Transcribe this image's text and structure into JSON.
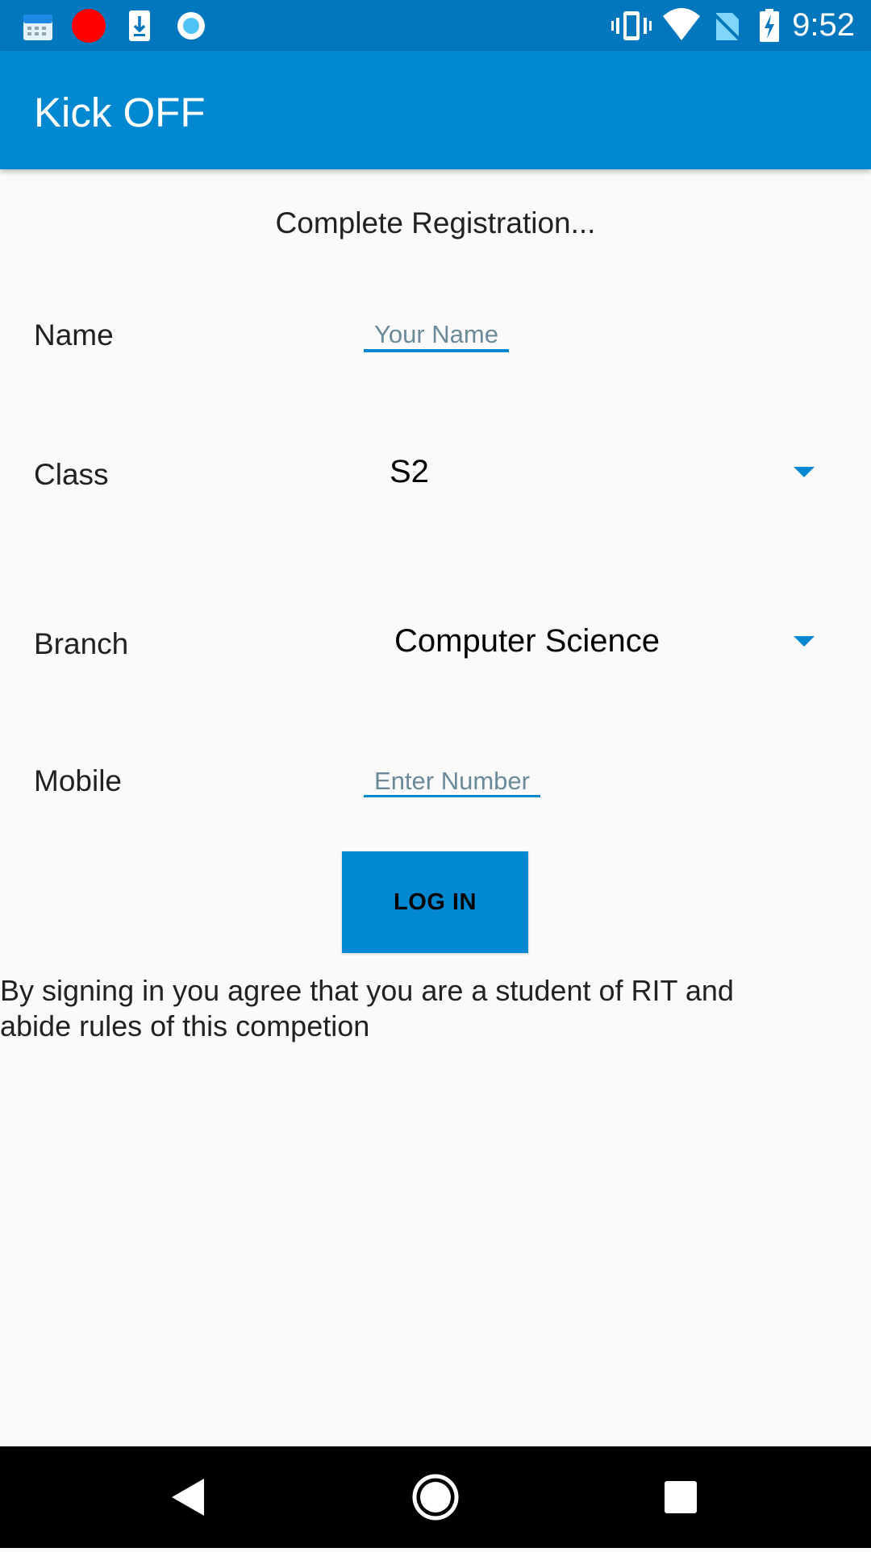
{
  "status_bar": {
    "time": "9:52",
    "icons": [
      "calendar-app-icon",
      "record-dot-icon",
      "download-icon",
      "sync-circle-icon",
      "vibrate-icon",
      "wifi-icon",
      "no-sim-icon",
      "battery-charging-icon"
    ]
  },
  "app_bar": {
    "title": "Kick OFF"
  },
  "form": {
    "heading": "Complete Registration...",
    "name_label": "Name",
    "name_placeholder": "Your Name",
    "name_value": "",
    "class_label": "Class",
    "class_selected": "S2",
    "branch_label": "Branch",
    "branch_selected": "Computer Science",
    "mobile_label": "Mobile",
    "mobile_placeholder": "Enter Number",
    "mobile_value": "",
    "login_label": "LOG IN",
    "disclaimer_line1": "By signing in you agree that you are a student of RIT and",
    "disclaimer_line2": "abide rules of this competion"
  },
  "nav_bar": {
    "buttons": [
      "back-icon",
      "home-icon",
      "recents-icon"
    ]
  },
  "colors": {
    "primary": "#0288d1",
    "primary_dark": "#0277bd",
    "background": "#fafafa"
  }
}
